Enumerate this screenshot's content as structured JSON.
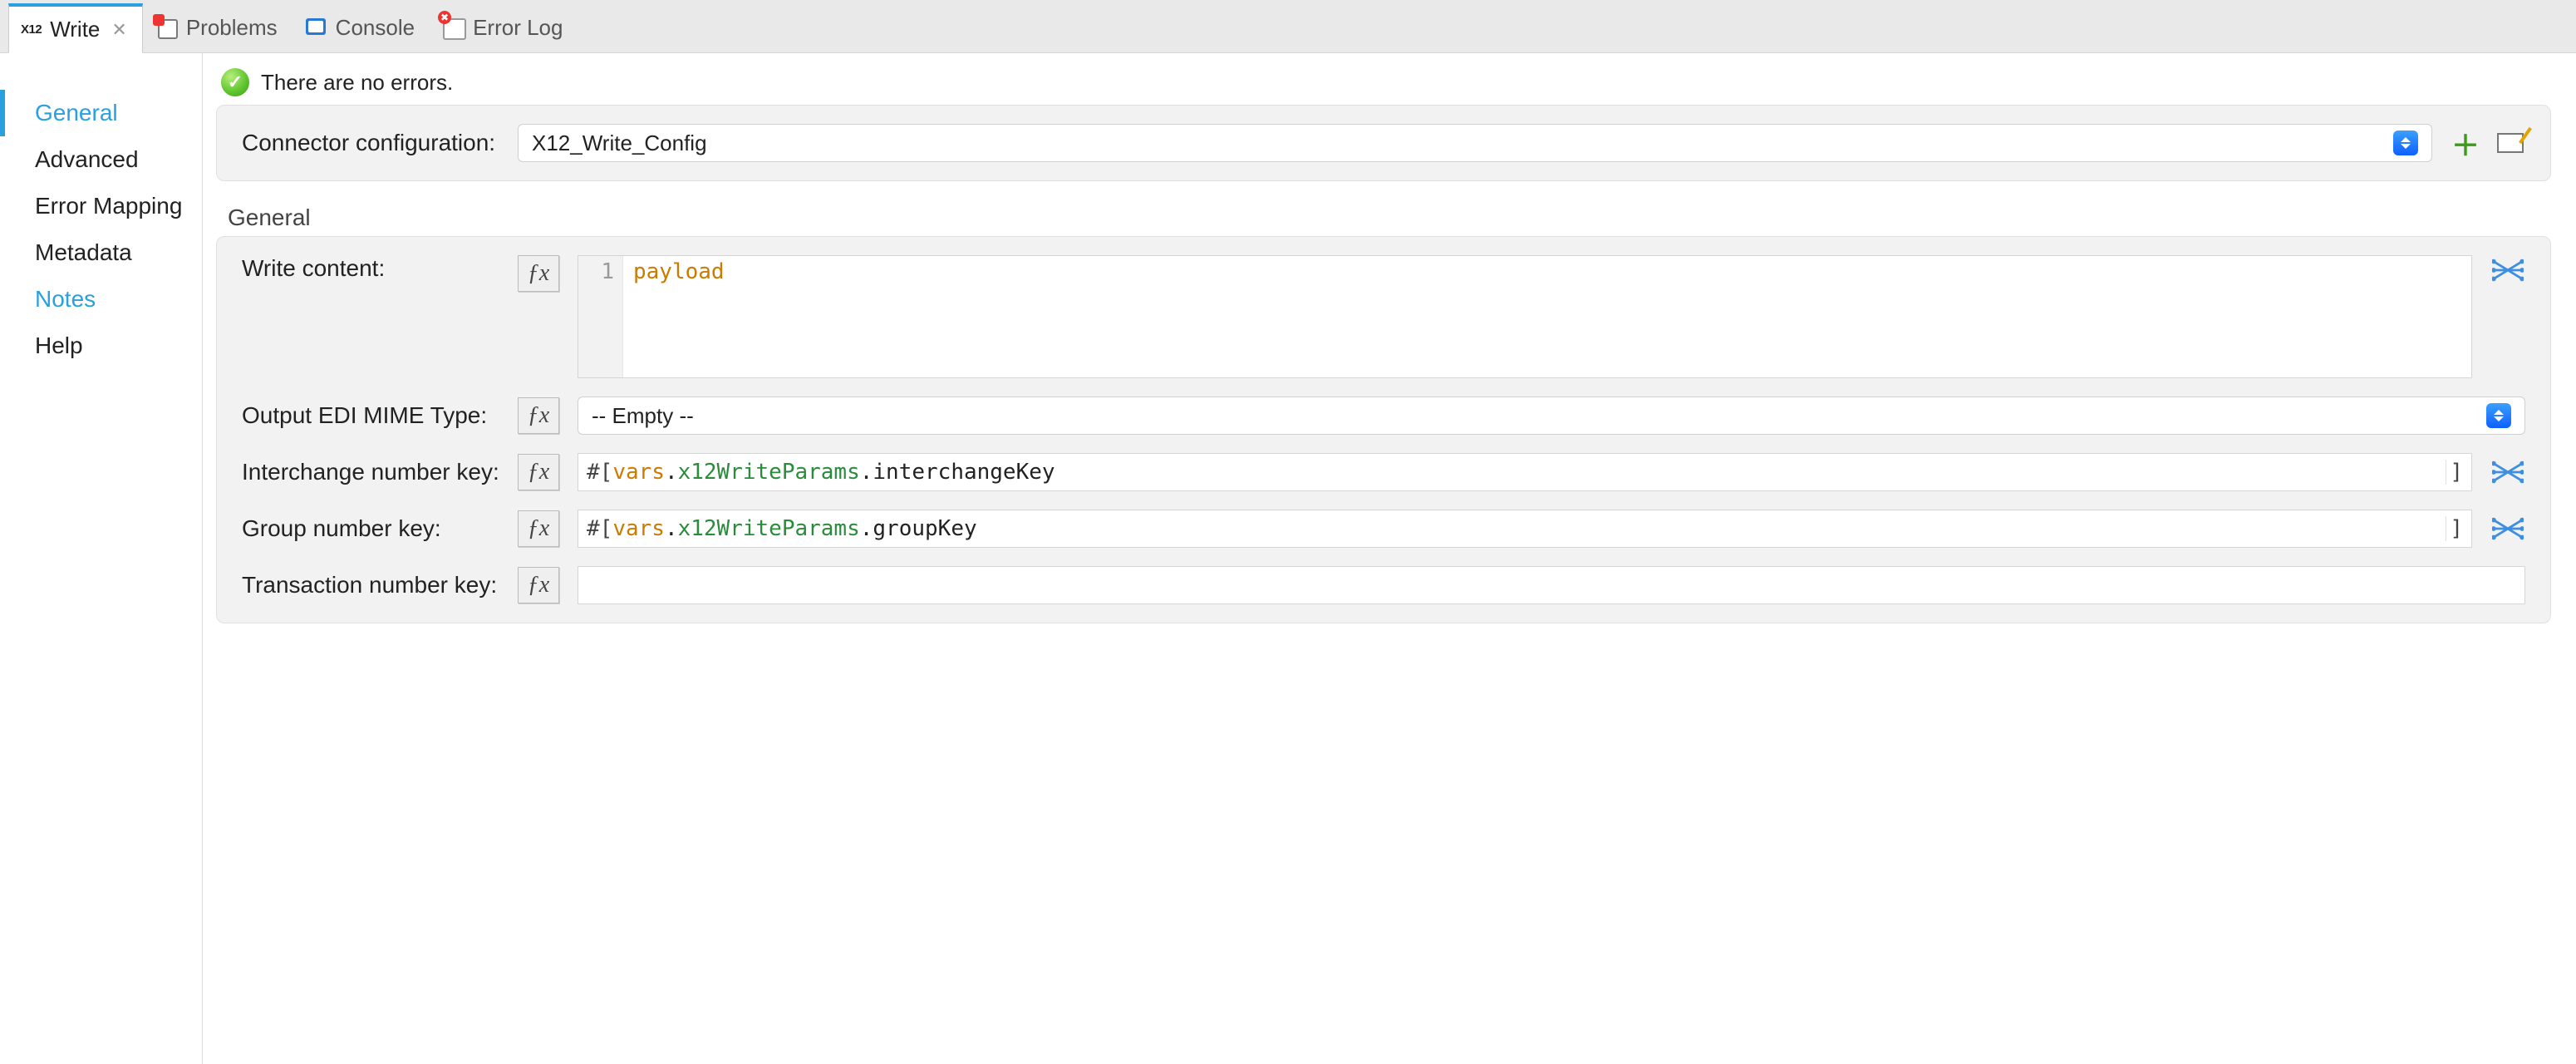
{
  "tabs": {
    "active": {
      "prefix": "X12",
      "label": "Write"
    },
    "others": [
      {
        "id": "problems",
        "label": "Problems"
      },
      {
        "id": "console",
        "label": "Console"
      },
      {
        "id": "error_log",
        "label": "Error Log"
      }
    ]
  },
  "sidebar": {
    "items": [
      {
        "id": "general",
        "label": "General",
        "active": true,
        "link": true
      },
      {
        "id": "advanced",
        "label": "Advanced",
        "active": false,
        "link": false
      },
      {
        "id": "error_mapping",
        "label": "Error Mapping",
        "active": false,
        "link": false
      },
      {
        "id": "metadata",
        "label": "Metadata",
        "active": false,
        "link": false
      },
      {
        "id": "notes",
        "label": "Notes",
        "active": false,
        "link": true
      },
      {
        "id": "help",
        "label": "Help",
        "active": false,
        "link": false
      }
    ]
  },
  "status": {
    "message": "There are no errors."
  },
  "config_row": {
    "label": "Connector configuration:",
    "value": "X12_Write_Config"
  },
  "section_title": "General",
  "fields": {
    "write_content": {
      "label": "Write content:",
      "line_no": "1",
      "code": "payload"
    },
    "output_mime": {
      "label": "Output EDI MIME Type:",
      "value": "-- Empty --"
    },
    "interchange_key": {
      "label": "Interchange number key:",
      "open": "#[ ",
      "p1": "vars",
      "p2": ".",
      "p3": "x12WriteParams",
      "p4": ".interchangeKey",
      "close": "]"
    },
    "group_key": {
      "label": "Group number key:",
      "open": "#[ ",
      "p1": "vars",
      "p2": ".",
      "p3": "x12WriteParams",
      "p4": ".groupKey",
      "close": "]"
    },
    "txn_key": {
      "label": "Transaction number key:",
      "value": ""
    }
  },
  "glyphs": {
    "fx": "ƒx",
    "ok": "✓",
    "close": "✕"
  }
}
